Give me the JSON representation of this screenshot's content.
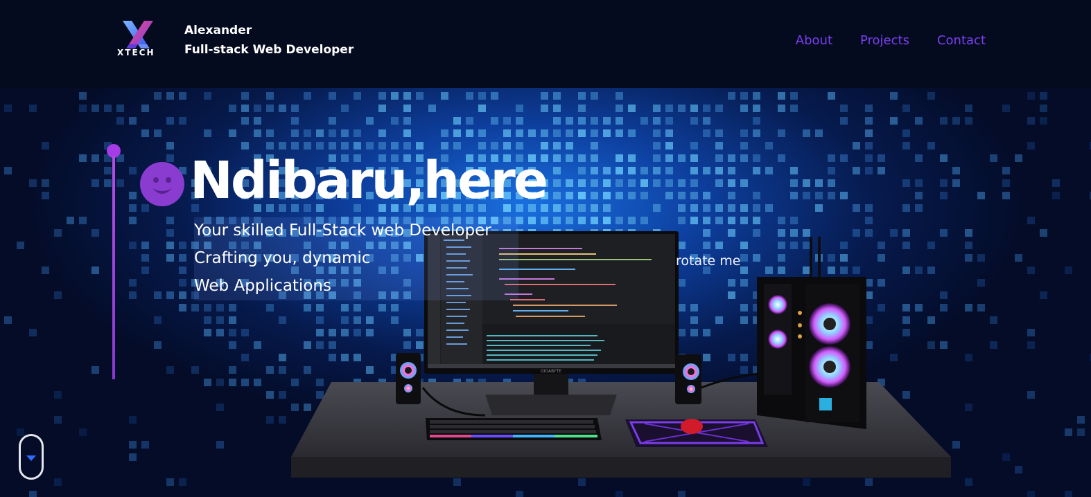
{
  "header": {
    "logo_text": "XTECH",
    "name": "Alexander",
    "role": "Full-stack Web Developer",
    "nav": [
      {
        "label": "About"
      },
      {
        "label": "Projects"
      },
      {
        "label": "Contact"
      }
    ]
  },
  "hero": {
    "headline": "Ndibaru,here",
    "subtitle_lines": [
      "Your skilled Full-Stack web Developer",
      "Crafting you, dynamic",
      "Web Applications"
    ],
    "interaction_hint": "rotate me",
    "smiley_icon": "smiley-face-icon",
    "monitor_brand": "GIGABYTE"
  },
  "scroll": {
    "icon": "scroll-down-arrow-icon"
  },
  "colors": {
    "accent_purple": "#7b3ff2",
    "timeline_purple": "#a43be6",
    "header_bg": "#050b1f",
    "hero_blue": "#1a6fe0"
  }
}
